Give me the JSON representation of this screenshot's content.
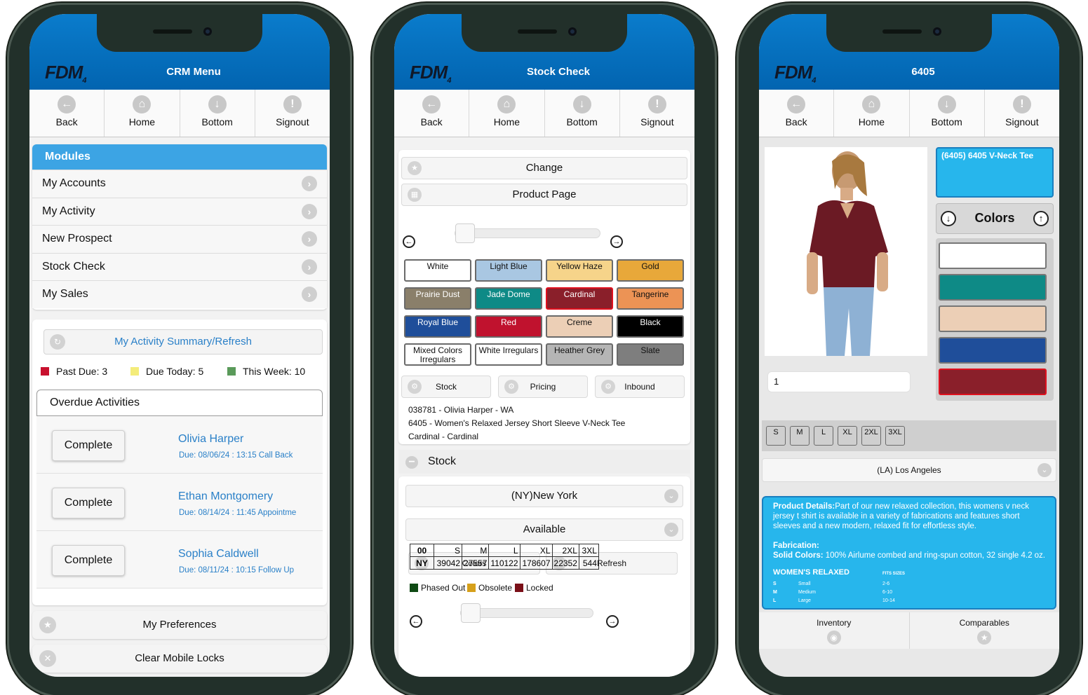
{
  "common": {
    "logo": "FDM",
    "logo_sub": "4",
    "nav": {
      "back": "Back",
      "home": "Home",
      "bottom": "Bottom",
      "signout": "Signout"
    }
  },
  "phone1": {
    "title": "CRM Menu",
    "modules_header": "Modules",
    "modules": [
      "My Accounts",
      "My Activity",
      "New Prospect",
      "Stock Check",
      "My Sales"
    ],
    "summary_button": "My Activity Summary/Refresh",
    "legend": [
      {
        "label": "Past Due: 3",
        "color": "#c8102e"
      },
      {
        "label": "Due Today: 5",
        "color": "#f4ec7a"
      },
      {
        "label": "This Week: 10",
        "color": "#5a9a5a"
      }
    ],
    "overdue_header": "Overdue Activities",
    "activities": [
      {
        "button": "Complete",
        "name": "Olivia Harper",
        "due": "Due: 08/06/24 : 13:15 Call Back"
      },
      {
        "button": "Complete",
        "name": "Ethan Montgomery",
        "due": "Due: 08/14/24 : 11:45 Appointme"
      },
      {
        "button": "Complete",
        "name": "Sophia Caldwell",
        "due": "Due: 08/11/24 : 10:15 Follow Up"
      }
    ],
    "preferences": "My Preferences",
    "clear_locks": "Clear Mobile Locks"
  },
  "phone2": {
    "title": "Stock Check",
    "change": "Change",
    "product_page": "Product Page",
    "colors": [
      {
        "label": "White",
        "bg": "#ffffff",
        "fg": "#111111"
      },
      {
        "label": "Light Blue",
        "bg": "#a9c7e2",
        "fg": "#111111"
      },
      {
        "label": "Yellow Haze",
        "bg": "#f6d48a",
        "fg": "#111111"
      },
      {
        "label": "Gold",
        "bg": "#e8a83a",
        "fg": "#111111"
      },
      {
        "label": "Prairie Dust",
        "bg": "#8a7f6a",
        "fg": "#ffffff"
      },
      {
        "label": "Jade Dome",
        "bg": "#0e8a86",
        "fg": "#ffffff"
      },
      {
        "label": "Cardinal",
        "bg": "#8a1f2a",
        "fg": "#ffffff"
      },
      {
        "label": "Tangerine",
        "bg": "#ec9355",
        "fg": "#111111"
      },
      {
        "label": "Royal Blue",
        "bg": "#1f4e9a",
        "fg": "#ffffff"
      },
      {
        "label": "Red",
        "bg": "#c0122e",
        "fg": "#ffffff"
      },
      {
        "label": "Creme",
        "bg": "#eccfb6",
        "fg": "#111111"
      },
      {
        "label": "Black",
        "bg": "#000000",
        "fg": "#ffffff"
      },
      {
        "label": "Mixed Colors Irregulars",
        "bg": "#ffffff",
        "fg": "#111111"
      },
      {
        "label": "White Irregulars",
        "bg": "#ffffff",
        "fg": "#111111"
      },
      {
        "label": "Heather Grey",
        "bg": "#b5b5b5",
        "fg": "#111111"
      },
      {
        "label": "Slate",
        "bg": "#7e7e7e",
        "fg": "#111111"
      }
    ],
    "tabs": {
      "stock": "Stock",
      "pricing": "Pricing",
      "inbound": "Inbound"
    },
    "info": {
      "line1": "038781 -  Olivia Harper - WA",
      "line2": "6405 - Women's Relaxed Jersey Short Sleeve V-Neck Tee",
      "line3": "Cardinal - Cardinal"
    },
    "stock_header": "Stock",
    "location": "(NY)New York",
    "availability": "Available",
    "colors_btn": "Colors",
    "refresh_btn": "Refresh",
    "legend": [
      {
        "label": "Phased Out",
        "color": "#0f4a14"
      },
      {
        "label": "Obsolete",
        "color": "#d6a01a"
      },
      {
        "label": "Locked",
        "color": "#7a0f18"
      }
    ],
    "table": {
      "header": [
        "00",
        "S",
        "M",
        "L",
        "XL",
        "2XL",
        "3XL"
      ],
      "row": [
        "NY",
        "39042",
        "27557",
        "110122",
        "178607",
        "22352",
        "544"
      ]
    }
  },
  "phone3": {
    "title": "6405",
    "product_label": "(6405) 6405 V-Neck Tee",
    "colors_header": "Colors",
    "swatches": [
      "#ffffff",
      "#0e8a86",
      "#eccfb6",
      "#1f4e9a",
      "#8a1f2a"
    ],
    "quantity": "1",
    "sizes": [
      "S",
      "M",
      "L",
      "XL",
      "2XL",
      "3XL"
    ],
    "location": "(LA) Los Angeles",
    "details_label": "Product Details:",
    "details_text": "Part of our new relaxed collection, this womens v neck jersey t shirt is available in a variety of fabrications and features short sleeves and a new modern, relaxed fit for effortless style.",
    "fabrication_label": "Fabrication:",
    "solid_label": "Solid Colors:",
    "solid_text": " 100% Airlume combed and ring-spun cotton, 32 single 4.2 oz.",
    "size_chart_title": "WOMEN'S RELAXED",
    "size_chart_sub": "FITS SIZES",
    "size_chart": [
      {
        "code": "S",
        "name": "Small",
        "fit": "2-6"
      },
      {
        "code": "M",
        "name": "Medium",
        "fit": "6-10"
      },
      {
        "code": "L",
        "name": "Large",
        "fit": "10-14"
      }
    ],
    "inventory": "Inventory",
    "comparables": "Comparables"
  }
}
